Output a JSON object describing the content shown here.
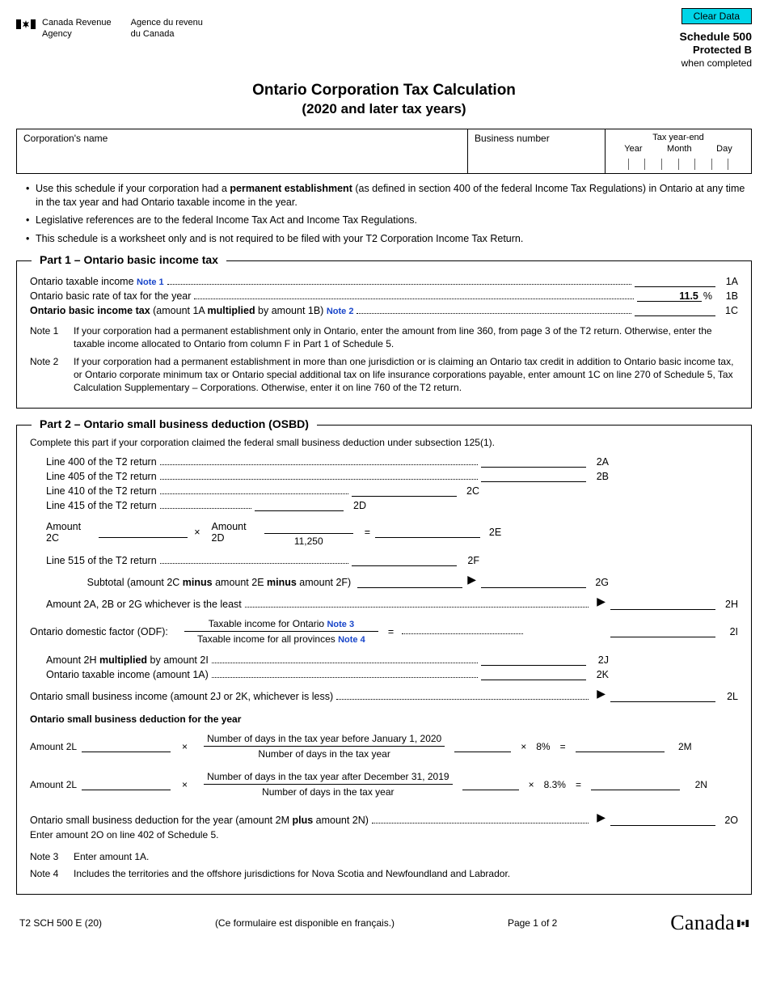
{
  "button_clear": "Clear Data",
  "agency_en1": "Canada Revenue",
  "agency_en2": "Agency",
  "agency_fr1": "Agence du revenu",
  "agency_fr2": "du Canada",
  "schedule": "Schedule 500",
  "protected": "Protected B",
  "when_completed": "when completed",
  "title": "Ontario Corporation Tax Calculation",
  "subtitle": "(2020 and later tax years)",
  "box_corp": "Corporation's name",
  "box_bn": "Business number",
  "box_ye": "Tax year-end",
  "ye_year": "Year",
  "ye_month": "Month",
  "ye_day": "Day",
  "bullets": {
    "b1a": "Use this schedule if your corporation had a ",
    "b1b": "permanent establishment",
    "b1c": " (as defined in section 400 of the federal Income Tax Regulations) in Ontario at any time in the tax year and had Ontario taxable income in the year.",
    "b2": "Legislative references are to the federal Income Tax Act and Income Tax Regulations.",
    "b3": "This schedule is a worksheet only and is not required to be filed with your T2 Corporation Income Tax Return."
  },
  "part1": {
    "title": "Part 1 – Ontario basic income tax",
    "r1": "Ontario taxable income",
    "note1": "Note 1",
    "c1": "1A",
    "r2": "Ontario basic rate of tax for the year",
    "rate": "11.5",
    "pct": "%",
    "c2": "1B",
    "r3a": "Ontario basic income tax",
    "r3b": " (amount 1A ",
    "r3c": "multiplied",
    "r3d": " by amount 1B) ",
    "note2": "Note 2",
    "c3": "1C",
    "n1": "Note 1",
    "n1t": "If your corporation had a permanent establishment only in Ontario, enter the amount from line 360, from page 3 of the T2 return. Otherwise, enter the taxable income allocated to Ontario from column F in Part 1 of Schedule 5.",
    "n2": "Note 2",
    "n2t": "If your corporation had a permanent establishment in more than one jurisdiction or is claiming an Ontario tax credit in addition to Ontario basic income tax, or Ontario corporate minimum tax or Ontario special additional tax on life insurance corporations payable, enter amount 1C on line 270 of Schedule 5, Tax Calculation Supplementary – Corporations. Otherwise, enter it on line 760 of the T2 return."
  },
  "part2": {
    "title": "Part 2 – Ontario small business deduction (OSBD)",
    "intro": "Complete this part if your corporation claimed the federal small business deduction under subsection 125(1).",
    "l400": "Line 400 of the T2 return",
    "c2a": "2A",
    "l405": "Line 405 of the T2 return",
    "c2b": "2B",
    "l410": "Line 410 of the T2 return",
    "c2c": "2C",
    "l415": "Line 415 of the T2 return",
    "c2d": "2D",
    "a2c": "Amount 2C",
    "times": "×",
    "a2d": "Amount 2D",
    "divisor": "11,250",
    "eq": "=",
    "c2e": "2E",
    "l515": "Line 515 of the T2 return",
    "c2f": "2F",
    "subtotal": "Subtotal (amount 2C minus amount 2E minus amount 2F)",
    "subtotal_pre": "Subtotal (amount 2C ",
    "minus": "minus",
    " amt2e": " amount 2E ",
    " amt2f": " amount 2F)",
    "c2g": "2G",
    "least": "Amount 2A, 2B or 2G whichever is the least",
    "c2h": "2H",
    "odf": "Ontario domestic factor (ODF):",
    "odf_num": "Taxable income for Ontario ",
    "note3": "Note 3",
    "odf_den": "Taxable income for all provinces ",
    "note4": "Note 4",
    "c2i": "2I",
    "a2h": "Amount 2H ",
    "mult": "multiplied",
    "by2i": " by amount 2I",
    "c2j": "2J",
    "oti": "Ontario taxable income (amount 1A)",
    "c2k": "2K",
    "osbi": "Ontario small business income (amount 2J or 2K, whichever is less)",
    "c2l": "2L",
    "osbd_hdr": "Ontario small business deduction for the year",
    "a2l": "Amount 2L",
    "frac1_num": "Number of days in the tax year before January 1, 2020",
    "frac_den": "Number of days in the tax year",
    "rate1": "8%",
    "c2m": "2M",
    "frac2_num": "Number of days in the tax year after December 31, 2019",
    "rate2": "8.3%",
    "c2n": "2N",
    "final_a": "Ontario small business deduction for the year (amount 2M ",
    "plus": "plus",
    "final_b": " amount 2N)",
    "final2": "Enter amount 2O on line 402 of Schedule 5.",
    "c2o": "2O",
    "n3": "Note 3",
    "n3t": "Enter amount 1A.",
    "n4": "Note 4",
    "n4t": "Includes the territories and the offshore jurisdictions for Nova Scotia and Newfoundland and Labrador."
  },
  "footer": {
    "code": "T2 SCH 500 E (20)",
    "fr": "(Ce formulaire est disponible en français.)",
    "page": "Page 1 of 2",
    "wordmark": "Canada"
  }
}
